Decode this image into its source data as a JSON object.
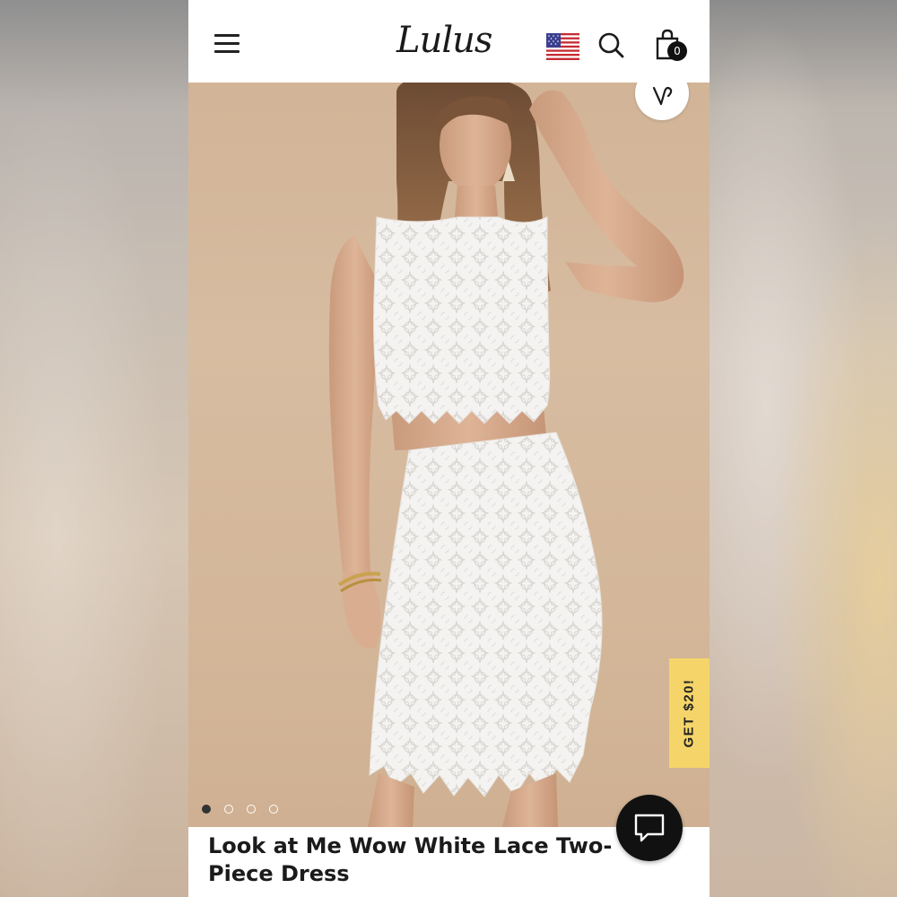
{
  "header": {
    "logo_text": "Lulus",
    "bag_count": "0",
    "icons": [
      "hamburger-menu-icon",
      "us-flag-icon",
      "search-icon",
      "shopping-bag-icon"
    ]
  },
  "hero": {
    "image_description_icon": "product-photo",
    "carousel": {
      "total": 4,
      "active": 1
    },
    "wishlist_icon": "heart-icon"
  },
  "promo": {
    "label": "GET $20!",
    "color": "#f5d56a"
  },
  "product": {
    "title": "Look at Me Wow White Lace Two-Piece Dress"
  },
  "chat": {
    "icon": "chat-bubble-icon"
  },
  "colors": {
    "accent_dark": "#111111",
    "promo_yellow": "#f5d56a",
    "photo_bg": "#d4b79a"
  }
}
